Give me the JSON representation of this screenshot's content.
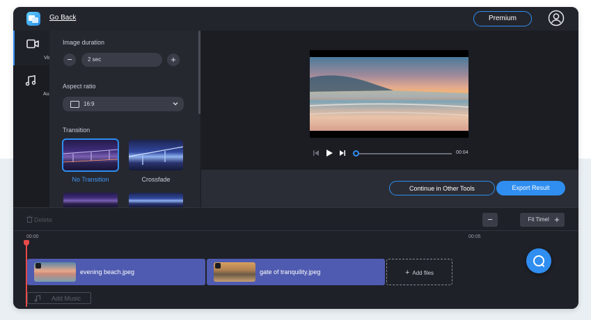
{
  "header": {
    "go_back": "Go Back",
    "premium": "Premium"
  },
  "sidenav": {
    "items": [
      {
        "label": "Video",
        "icon": "video-camera-icon"
      },
      {
        "label": "Audio",
        "icon": "music-note-icon"
      }
    ]
  },
  "settings": {
    "image_duration": {
      "title": "Image duration",
      "value": "2 sec"
    },
    "aspect_ratio": {
      "title": "Aspect ratio",
      "value": "16:9"
    },
    "transition": {
      "title": "Transition",
      "options": [
        {
          "label": "No Transition",
          "selected": true
        },
        {
          "label": "Crossfade",
          "selected": false
        }
      ]
    }
  },
  "player": {
    "time": "00:04"
  },
  "actions": {
    "continue": "Continue in Other Tools",
    "export": "Export Result"
  },
  "timeline": {
    "delete": "Delete",
    "fit": "Fit Timeline",
    "ticks": [
      "00:00",
      "00:05"
    ],
    "clips": [
      {
        "name": "evening beach.jpeg"
      },
      {
        "name": "gate of tranquility.jpeg"
      }
    ],
    "add_files": "Add files",
    "add_music": "Add Music"
  },
  "colors": {
    "accent": "#2f8ef0",
    "app_bg": "#1f2128",
    "clip_bg": "#4e5bb0",
    "playhead": "#e84a4a"
  }
}
